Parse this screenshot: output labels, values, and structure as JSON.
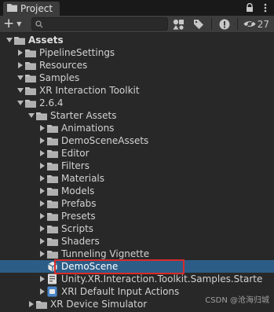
{
  "window": {
    "tab_title": "Project",
    "hidden_count": "27"
  },
  "colors": {
    "background": "#282828",
    "toolbar": "#3c3c3c",
    "selection": "#2c5d87",
    "highlight_border": "#d92b2b",
    "folder": "#c2c2c2"
  },
  "icons": {
    "tab": "folder-tab-icon",
    "lock": "lock-icon",
    "menu": "kebab-menu-icon",
    "add": "plus-icon",
    "search_by_type": "shapes-icon",
    "search_by_label": "tag-icon",
    "warnings": "exclamation-icon",
    "hidden_packages": "eye-icon"
  },
  "tree": [
    {
      "label": "Assets",
      "bold": true
    },
    {
      "label": "PipelineSettings"
    },
    {
      "label": "Resources"
    },
    {
      "label": "Samples"
    },
    {
      "label": "XR Interaction Toolkit"
    },
    {
      "label": "2.6.4"
    },
    {
      "label": "Starter Assets"
    },
    {
      "label": "Animations"
    },
    {
      "label": "DemoSceneAssets"
    },
    {
      "label": "Editor"
    },
    {
      "label": "Filters"
    },
    {
      "label": "Materials"
    },
    {
      "label": "Models"
    },
    {
      "label": "Prefabs"
    },
    {
      "label": "Presets"
    },
    {
      "label": "Scripts"
    },
    {
      "label": "Shaders"
    },
    {
      "label": "Tunneling Vignette"
    },
    {
      "label": "DemoScene",
      "selected": true
    },
    {
      "label": "Unity.XR.Interaction.Toolkit.Samples.Starte"
    },
    {
      "label": "XRI Default Input Actions"
    },
    {
      "label": "XR Device Simulator"
    }
  ],
  "watermark": "CSDN @沧海归城"
}
